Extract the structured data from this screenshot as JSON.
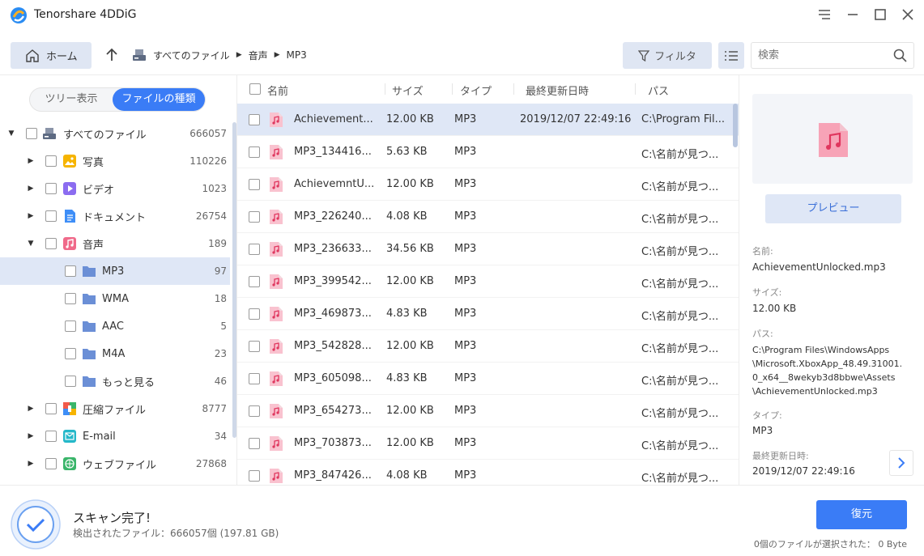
{
  "app": {
    "title": "Tenorshare 4DDiG"
  },
  "nav": {
    "home_label": "ホーム",
    "breadcrumb": [
      "すべてのファイル",
      "音声",
      "MP3"
    ],
    "filter_label": "フィルタ",
    "search_placeholder": "検索"
  },
  "sidebar": {
    "view_tree": "ツリー表示",
    "view_type": "ファイルの種類",
    "items": [
      {
        "label": "すべてのファイル",
        "count": "666057",
        "icon": "drive-icon"
      },
      {
        "label": "写真",
        "count": "110226",
        "icon": "photo-icon"
      },
      {
        "label": "ビデオ",
        "count": "1023",
        "icon": "video-icon"
      },
      {
        "label": "ドキュメント",
        "count": "26754",
        "icon": "document-icon"
      },
      {
        "label": "音声",
        "count": "189",
        "icon": "audio-icon"
      },
      {
        "label": "MP3",
        "count": "97",
        "icon": "folder-icon"
      },
      {
        "label": "WMA",
        "count": "18",
        "icon": "folder-icon"
      },
      {
        "label": "AAC",
        "count": "5",
        "icon": "folder-icon"
      },
      {
        "label": "M4A",
        "count": "23",
        "icon": "folder-icon"
      },
      {
        "label": "もっと見る",
        "count": "46",
        "icon": "folder-icon"
      },
      {
        "label": "圧縮ファイル",
        "count": "8777",
        "icon": "archive-icon"
      },
      {
        "label": "E-mail",
        "count": "34",
        "icon": "email-icon"
      },
      {
        "label": "ウェブファイル",
        "count": "27868",
        "icon": "web-icon"
      }
    ]
  },
  "list": {
    "headers": {
      "name": "名前",
      "size": "サイズ",
      "type": "タイプ",
      "modified": "最終更新日時",
      "path": "パス"
    },
    "rows": [
      {
        "name": "Achievement...",
        "size": "12.00 KB",
        "type": "MP3",
        "modified": "2019/12/07 22:49:16",
        "path": "C:\\Program Fil..."
      },
      {
        "name": "MP3_134416...",
        "size": "5.63 KB",
        "type": "MP3",
        "modified": "",
        "path": "C:\\名前が見つ..."
      },
      {
        "name": "AchievemntU...",
        "size": "12.00 KB",
        "type": "MP3",
        "modified": "",
        "path": "C:\\名前が見つ..."
      },
      {
        "name": "MP3_226240...",
        "size": "4.08 KB",
        "type": "MP3",
        "modified": "",
        "path": "C:\\名前が見つ..."
      },
      {
        "name": "MP3_236633...",
        "size": "34.56 KB",
        "type": "MP3",
        "modified": "",
        "path": "C:\\名前が見つ..."
      },
      {
        "name": "MP3_399542...",
        "size": "12.00 KB",
        "type": "MP3",
        "modified": "",
        "path": "C:\\名前が見つ..."
      },
      {
        "name": "MP3_469873...",
        "size": "4.83 KB",
        "type": "MP3",
        "modified": "",
        "path": "C:\\名前が見つ..."
      },
      {
        "name": "MP3_542828...",
        "size": "12.00 KB",
        "type": "MP3",
        "modified": "",
        "path": "C:\\名前が見つ..."
      },
      {
        "name": "MP3_605098...",
        "size": "4.83 KB",
        "type": "MP3",
        "modified": "",
        "path": "C:\\名前が見つ..."
      },
      {
        "name": "MP3_654273...",
        "size": "12.00 KB",
        "type": "MP3",
        "modified": "",
        "path": "C:\\名前が見つ..."
      },
      {
        "name": "MP3_703873...",
        "size": "12.00 KB",
        "type": "MP3",
        "modified": "",
        "path": "C:\\名前が見つ..."
      },
      {
        "name": "MP3_847426...",
        "size": "4.08 KB",
        "type": "MP3",
        "modified": "",
        "path": "C:\\名前が見つ..."
      }
    ]
  },
  "details": {
    "preview_label": "プレビュー",
    "name_key": "名前:",
    "name_value": "AchievementUnlocked.mp3",
    "size_key": "サイズ:",
    "size_value": "12.00 KB",
    "path_key": "パス:",
    "path_lines": [
      "C:\\Program Files\\WindowsApps",
      "\\Microsoft.XboxApp_48.49.31001.",
      "0_x64__8wekyb3d8bbwe\\Assets",
      "\\AchievementUnlocked.mp3"
    ],
    "type_key": "タイプ:",
    "type_value": "MP3",
    "modified_key": "最終更新日時:",
    "modified_value": "2019/12/07 22:49:16"
  },
  "footer": {
    "status_title": "スキャン完了!",
    "status_detail": "検出されたファイル：666057個 (197.81 GB)",
    "restore_label": "復元",
    "selection_status": "0個のファイルが選択された： 0 Byte"
  },
  "colors": {
    "accent": "#3a7cf6",
    "selected_row": "#dfe7f6",
    "audio_pink": "#f06a8a"
  }
}
